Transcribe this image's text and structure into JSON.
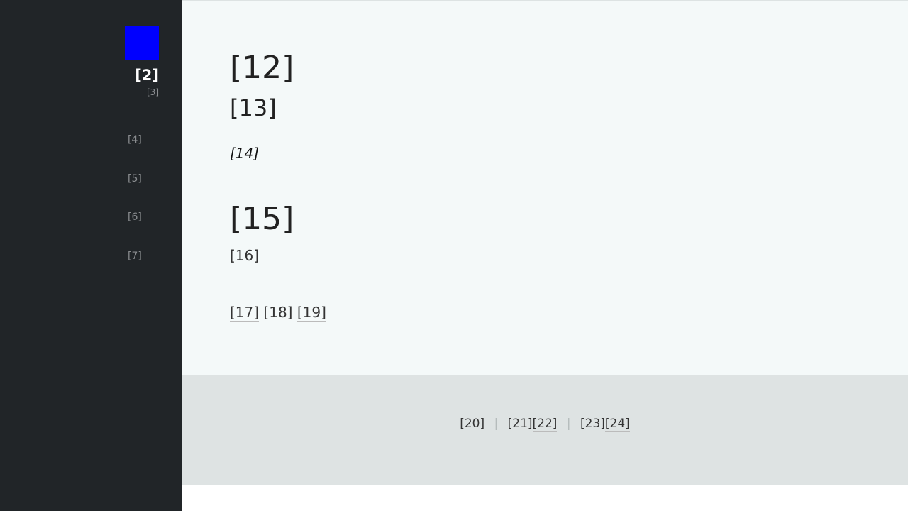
{
  "sidebar": {
    "logo_color": "#0000ff",
    "site_name": "[2]",
    "site_subtitle": "[3]",
    "nav": [
      "[4]",
      "[5]",
      "[6]",
      "[7]"
    ]
  },
  "main": {
    "title": "[12]",
    "subtitle": "[13]",
    "meta": "[14]",
    "section_title": "[15]",
    "section_text": "[16]",
    "links_line": {
      "link1": "[17]",
      "text": "[18]",
      "link2": "[19]"
    }
  },
  "footer": {
    "item1": "[20]",
    "item2_text": "[21]",
    "item2_link": "[22]",
    "item3_text": "[23]",
    "item3_link": "[24]",
    "separator": "|"
  }
}
